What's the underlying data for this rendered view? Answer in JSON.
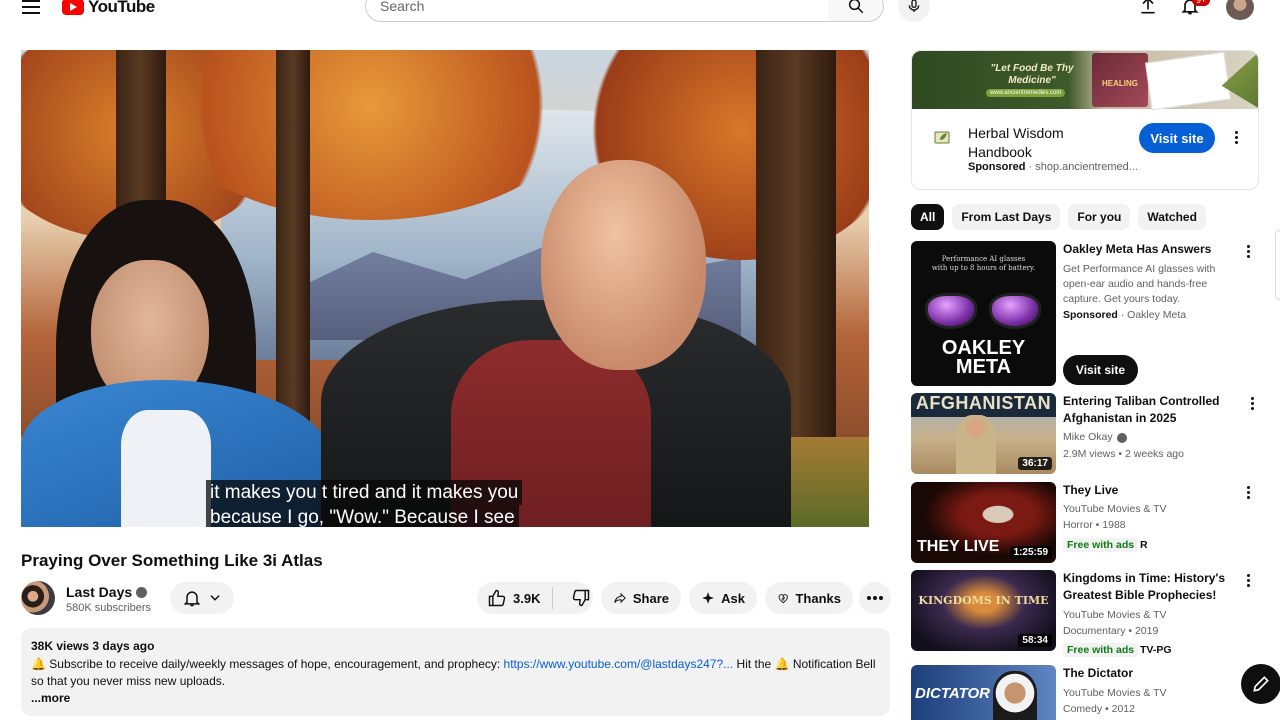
{
  "header": {
    "logo_text": "YouTube",
    "search_placeholder": "Search",
    "notification_count": "9+"
  },
  "video": {
    "captions": [
      "it makes you t tired and it makes you",
      "because I go, \"Wow.\" Because I see"
    ],
    "title": "Praying Over Something Like 3i Atlas"
  },
  "channel": {
    "name": "Last Days",
    "subscribers": "580K subscribers"
  },
  "actions": {
    "likes": "3.9K",
    "share": "Share",
    "ask": "Ask",
    "thanks": "Thanks"
  },
  "description": {
    "meta": "38K views  3 days ago",
    "text_before": "🔔 Subscribe to receive daily/weekly messages of hope, encouragement, and prophecy: ",
    "link": "https://www.youtube.com/@lastdays247?...",
    "text_after": " Hit the 🔔 Notification Bell so that you never miss new uploads.",
    "more": "...more"
  },
  "ad": {
    "banner_text": "\"Let Food Be Thy Medicine\"",
    "banner_url": "www.ancientremedies.com",
    "banner_book": "HEALING",
    "title": "Herbal Wisdom Handbook",
    "sponsored": "Sponsored",
    "domain": "· shop.ancientremed...",
    "cta": "Visit site"
  },
  "chips": [
    "All",
    "From Last Days",
    "For you",
    "Watched"
  ],
  "recommendations": [
    {
      "title": "Oakley Meta Has Answers",
      "description": "Get Performance AI glasses with open-ear audio and hands-free capture. Get yours today.",
      "sponsored": "Sponsored",
      "advertiser": "· Oakley Meta",
      "cta": "Visit site",
      "thumb_line1": "Performance AI glasses",
      "thumb_line2": "with up to 8 hours of battery.",
      "thumb_brand1": "OAKLEY",
      "thumb_brand2": "META"
    },
    {
      "title": "Entering Taliban Controlled Afghanistan in 2025",
      "channel": "Mike Okay",
      "meta": "2.9M views • 2 weeks ago",
      "duration": "36:17",
      "thumb_text": "AFGHANISTAN"
    },
    {
      "title": "They Live",
      "channel": "YouTube Movies & TV",
      "meta": "Horror • 1988",
      "badge": "Free with ads",
      "rating": "R",
      "duration": "1:25:59",
      "thumb_text": "THEY LIVE"
    },
    {
      "title": "Kingdoms in Time: History's Greatest Bible Prophecies!",
      "channel": "YouTube Movies & TV",
      "meta": "Documentary • 2019",
      "badge": "Free with ads",
      "rating": "TV-PG",
      "duration": "58:34",
      "thumb_text": "KINGDOMS IN TIME"
    },
    {
      "title": "The Dictator",
      "channel": "YouTube Movies & TV",
      "meta": "Comedy • 2012",
      "thumb_text": "DICTATOR"
    }
  ],
  "colors": {
    "brand_red": "#ff0000",
    "link_blue": "#065fd4",
    "free_green": "#0c7a16"
  }
}
